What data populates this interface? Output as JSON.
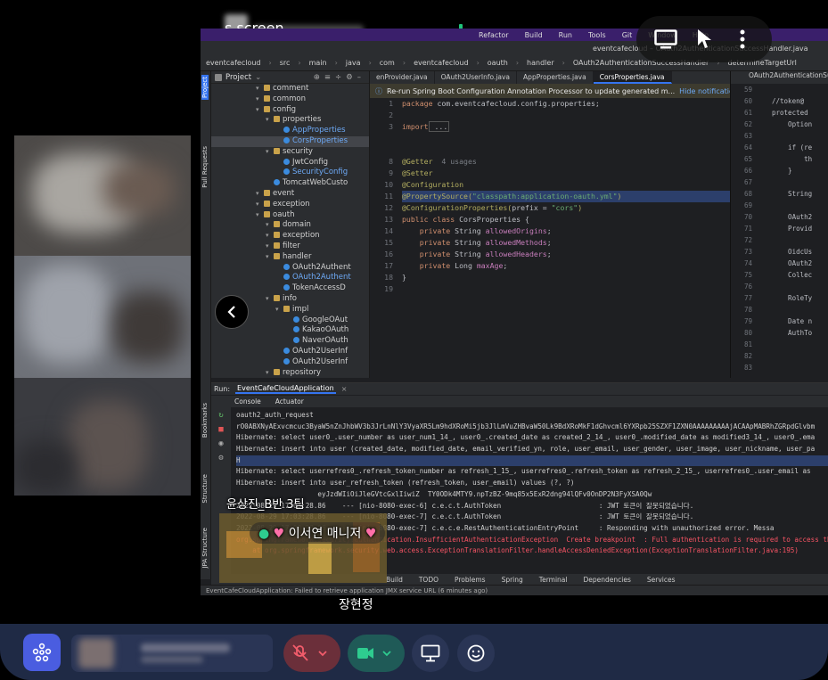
{
  "share": {
    "title": "s screen"
  },
  "ide": {
    "mac_menu": [
      "Refactor",
      "Build",
      "Run",
      "Tools",
      "Git",
      "Window",
      "Help"
    ],
    "window_title": "eventcafecloud – OAuth2AuthenticationSuccessHandler.java",
    "breadcrumb": [
      "eventcafecloud",
      "src",
      "main",
      "java",
      "com",
      "eventcafecloud",
      "oauth",
      "handler",
      "OAuth2AuthenticationSuccessHandler",
      "determineTargetUrl"
    ],
    "project_label": "Project",
    "side_tabs": [
      "Project",
      "Pull Requests",
      "Bookmarks",
      "Structure",
      "JPA Structure"
    ],
    "tree": [
      {
        "label": "comment",
        "type": "folder",
        "indent": 0
      },
      {
        "label": "common",
        "type": "folder",
        "indent": 0
      },
      {
        "label": "config",
        "type": "folder",
        "indent": 0
      },
      {
        "label": "properties",
        "type": "folder",
        "indent": 1
      },
      {
        "label": "AppProperties",
        "type": "class",
        "indent": 2,
        "blue": true
      },
      {
        "label": "CorsProperties",
        "type": "class",
        "indent": 2,
        "blue": true,
        "selected": true
      },
      {
        "label": "security",
        "type": "folder",
        "indent": 1
      },
      {
        "label": "JwtConfig",
        "type": "class",
        "indent": 2
      },
      {
        "label": "SecurityConfig",
        "type": "class",
        "indent": 2,
        "blue": true
      },
      {
        "label": "TomcatWebCusto",
        "type": "class",
        "indent": 1
      },
      {
        "label": "event",
        "type": "folder",
        "indent": 0
      },
      {
        "label": "exception",
        "type": "folder",
        "indent": 0
      },
      {
        "label": "oauth",
        "type": "folder",
        "indent": 0
      },
      {
        "label": "domain",
        "type": "folder",
        "indent": 1
      },
      {
        "label": "exception",
        "type": "folder",
        "indent": 1
      },
      {
        "label": "filter",
        "type": "folder",
        "indent": 1
      },
      {
        "label": "handler",
        "type": "folder",
        "indent": 1
      },
      {
        "label": "OAuth2Authent",
        "type": "class",
        "indent": 2
      },
      {
        "label": "OAuth2Authent",
        "type": "class",
        "indent": 2,
        "blue": true
      },
      {
        "label": "TokenAccessD",
        "type": "class",
        "indent": 2
      },
      {
        "label": "info",
        "type": "folder",
        "indent": 1
      },
      {
        "label": "impl",
        "type": "folder",
        "indent": 2
      },
      {
        "label": "GoogleOAut",
        "type": "class",
        "indent": 3
      },
      {
        "label": "KakaoOAuth",
        "type": "class",
        "indent": 3
      },
      {
        "label": "NaverOAuth",
        "type": "class",
        "indent": 3
      },
      {
        "label": "OAuth2UserInf",
        "type": "class",
        "indent": 2
      },
      {
        "label": "OAuth2UserInf",
        "type": "class",
        "indent": 2
      },
      {
        "label": "repository",
        "type": "folder",
        "indent": 1
      }
    ],
    "tabs": [
      {
        "label": "enProvider.java",
        "active": false
      },
      {
        "label": "OAuth2UserInfo.java",
        "active": false
      },
      {
        "label": "AppProperties.java",
        "active": false
      },
      {
        "label": "CorsProperties.java",
        "active": true
      }
    ],
    "right_tab": "OAuth2AuthenticationSucc",
    "notice": {
      "text": "Re-run Spring Boot Configuration Annotation Processor to update generated m...",
      "action": "Hide notification"
    },
    "line_numbers": [
      "1",
      "2",
      "3",
      "",
      "",
      "8",
      "9",
      "10",
      "11",
      "12",
      "13",
      "14",
      "15",
      "16",
      "17",
      "18",
      "19"
    ],
    "right_line_numbers": [
      "59",
      "60",
      "61",
      "62",
      "63",
      "64",
      "65",
      "66",
      "67",
      "68",
      "69",
      "70",
      "71",
      "72",
      "73",
      "74",
      "75",
      "76",
      "77",
      "78",
      "79",
      "80",
      "81",
      "82",
      "83"
    ],
    "right_code": [
      "",
      "//token@",
      "protected",
      "    Option",
      "",
      "    if (re",
      "        th",
      "    }",
      "",
      "    String",
      "",
      "    OAuth2",
      "    Provid",
      "",
      "    OidcUs",
      "    OAuth2",
      "    Collec",
      "",
      "    RoleTy",
      "",
      "    Date n",
      "    AuthTo",
      "",
      "",
      ""
    ],
    "usages": "4 usages",
    "code": {
      "package_kw": "package",
      "package_name": " com.eventcafecloud.config.properties;",
      "import_kw": "import",
      "import_rest": " ...",
      "getter": "@Getter",
      "setter": "@Setter",
      "configuration": "@Configuration",
      "property_source": "@PropertySource(",
      "property_source_value": "\"classpath:application-oauth.yml\"",
      "property_source_end": ")",
      "config_props": "@ConfigurationProperties(",
      "prefix_param": "prefix = ",
      "prefix_value": "\"cors\"",
      "config_props_end": ")",
      "class_decl_kw": "public class",
      "class_name": " CorsProperties {",
      "field1_kw": "    private",
      "field1_type": " String ",
      "field1_name": "allowedOrigins",
      "field2_kw": "    private",
      "field2_type": " String ",
      "field2_name": "allowedMethods",
      "field3_kw": "    private",
      "field3_type": " String ",
      "field3_name": "allowedHeaders",
      "field4_kw": "    private",
      "field4_type": " Long ",
      "field4_name": "maxAge",
      "semi": ";",
      "close": "}"
    },
    "run": {
      "label": "Run:",
      "app": "EventCafeCloudApplication",
      "console_tab": "Console",
      "actuator_tab": "Actuator"
    },
    "console": [
      {
        "text": "oauth2_auth_request",
        "cls": ""
      },
      {
        "text": "rO0ABXNyAExvcmcuc3ByaW5nZnJhbWV3b3JrLnNlY3VyaXR5Lm9hdXRoMi5jb3JlLmVuZHBvaW50Lk9BdXRoMkF1dGhvcml6YXRpb25SZXF1ZXN0AAAAAAAAAjACAApMABRhZGRpdGlvbm",
        "cls": ""
      },
      {
        "text": "Hibernate: select user0_.user_number as user_num1_14_, user0_.created_date as created_2_14_, user0_.modified_date as modified3_14_, user0_.ema",
        "cls": ""
      },
      {
        "text": "Hibernate: insert into user (created_date, modified_date, email_verified_yn, role, user_email, user_gender, user_image, user_nickname, user_pa",
        "cls": ""
      },
      {
        "text": "H",
        "cls": "hl"
      },
      {
        "text": "Hibernate: select userrefres0_.refresh_token_number as refresh_1_15_, userrefres0_.refresh_token as refresh_2_15_, userrefres0_.user_email as",
        "cls": ""
      },
      {
        "text": "Hibernate: insert into user_refresh_token (refresh_token, user_email) values (?, ?)",
        "cls": ""
      },
      {
        "text": "                    eyJzdWIiOiJleGVtcGxlIiwiZ  TY0ODk4MTY9.npTzBZ-9mq85x5ExR2dng94lQFv0OnDP2N3FyXSA0Qw",
        "cls": ""
      },
      {
        "text": "2022-08-29 17:03:28.86    --- [nio-8080-exec-6] c.e.c.t.AuthToken                        : JWT 토큰이 잘못되었습니다.",
        "cls": ""
      },
      {
        "text": "2022-08-29 17:03:28.86    --- [nio-8080-exec-7] c.e.c.t.AuthToken                        : JWT 토큰이 잘못되었습니다.",
        "cls": ""
      },
      {
        "text": "2022-08-29 17:03:28.86    --- [nio-8080-exec-7] c.e.c.e.RestAuthenticationEntryPoint     : Responding with unauthorized error. Messa",
        "cls": ""
      },
      {
        "text": "org.springframework.security.authentication.InsufficientAuthenticationException  Create breakpoint  : Full authentication is required to access this",
        "cls": "err"
      },
      {
        "text": "    at org.springframework.security.web.access.ExceptionTranslationFilter.handleAccessDeniedException(ExceptionTranslationFilter.java:195)",
        "cls": "err"
      }
    ],
    "bottom_tabs": [
      "Build",
      "TODO",
      "Problems",
      "Spring",
      "Terminal",
      "Dependencies",
      "Services"
    ],
    "status": "EventCafeCloudApplication: Failed to retrieve application JMX service URL (6 minutes ago)"
  },
  "participants": {
    "name1": "윤상진_B반 3팀",
    "name2": "이서연 매니저",
    "name3": "장현정"
  },
  "colors": {
    "accent": "#4a5de0",
    "mic_muted": "#f25c6b",
    "camera_on": "#2ecc8f",
    "bottom_bar": "#1f2a45"
  }
}
